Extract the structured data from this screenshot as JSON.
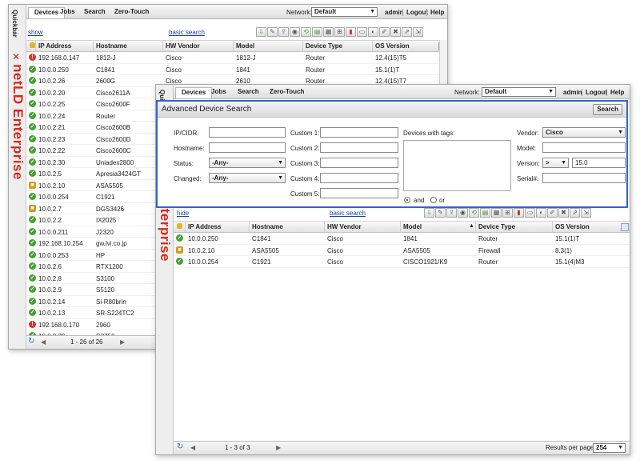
{
  "nav": {
    "tabs": [
      "Devices",
      "Jobs",
      "Search",
      "Zero-Touch"
    ],
    "network_label": "Network:",
    "network_value": "Default",
    "admin": "admin",
    "logout": "Logout",
    "help": "Help"
  },
  "sidebar": {
    "quickbar_label": "Quickbar",
    "brand": "netLD Enterprise"
  },
  "w1": {
    "toggle": "show",
    "basic_search": "basic search",
    "columns": [
      "IP Address",
      "Hostname",
      "HW Vendor",
      "Model",
      "Device Type",
      "OS Version"
    ],
    "rows": [
      {
        "status": "err",
        "ip": "192.168.0.147",
        "host": "1812-J",
        "vendor": "Cisco",
        "model": "1812-J",
        "type": "Router",
        "os": "12.4(15)T5"
      },
      {
        "status": "ok",
        "ip": "10.0.0.250",
        "host": "C1841",
        "vendor": "Cisco",
        "model": "1841",
        "type": "Router",
        "os": "15.1(1)T"
      },
      {
        "status": "ok",
        "ip": "10.0.2.26",
        "host": "2600G",
        "vendor": "Cisco",
        "model": "2610",
        "type": "Router",
        "os": "12.4(15)T7"
      },
      {
        "status": "ok",
        "ip": "10.0.2.20",
        "host": "Cisco2611A",
        "vendor": "",
        "model": "",
        "type": "",
        "os": ""
      },
      {
        "status": "ok",
        "ip": "10.0.2.25",
        "host": "Cisco2600F",
        "vendor": "",
        "model": "",
        "type": "",
        "os": ""
      },
      {
        "status": "ok",
        "ip": "10.0.2.24",
        "host": "Router",
        "vendor": "",
        "model": "",
        "type": "",
        "os": ""
      },
      {
        "status": "ok",
        "ip": "10.0.2.21",
        "host": "Cisco2600B",
        "vendor": "",
        "model": "",
        "type": "",
        "os": ""
      },
      {
        "status": "ok",
        "ip": "10.0.2.23",
        "host": "Cisco2600D",
        "vendor": "",
        "model": "",
        "type": "",
        "os": ""
      },
      {
        "status": "ok",
        "ip": "10.0.2.22",
        "host": "Cisco2600C",
        "vendor": "",
        "model": "",
        "type": "",
        "os": ""
      },
      {
        "status": "ok",
        "ip": "10.0.2.30",
        "host": "Uniadex2800",
        "vendor": "",
        "model": "",
        "type": "",
        "os": ""
      },
      {
        "status": "ok",
        "ip": "10.0.2.5",
        "host": "Apresia3424GT",
        "vendor": "",
        "model": "",
        "type": "",
        "os": ""
      },
      {
        "status": "warn",
        "ip": "10.0.2.10",
        "host": "ASA5505",
        "vendor": "",
        "model": "",
        "type": "",
        "os": ""
      },
      {
        "status": "ok",
        "ip": "10.0.0.254",
        "host": "C1921",
        "vendor": "",
        "model": "",
        "type": "",
        "os": ""
      },
      {
        "status": "warn",
        "ip": "10.0.2.7",
        "host": "DGS3426",
        "vendor": "",
        "model": "",
        "type": "",
        "os": ""
      },
      {
        "status": "ok",
        "ip": "10.0.2.2",
        "host": "IX2025",
        "vendor": "",
        "model": "",
        "type": "",
        "os": ""
      },
      {
        "status": "ok",
        "ip": "10.0.0.211",
        "host": "J2320",
        "vendor": "",
        "model": "",
        "type": "",
        "os": ""
      },
      {
        "status": "ok",
        "ip": "192.168.10.254",
        "host": "gw.lvi.co.jp",
        "vendor": "",
        "model": "",
        "type": "",
        "os": ""
      },
      {
        "status": "ok",
        "ip": "10.0.0.253",
        "host": "HP",
        "vendor": "",
        "model": "",
        "type": "",
        "os": ""
      },
      {
        "status": "ok",
        "ip": "10.0.2.6",
        "host": "RTX1200",
        "vendor": "",
        "model": "",
        "type": "",
        "os": ""
      },
      {
        "status": "ok",
        "ip": "10.0.2.8",
        "host": "S3100",
        "vendor": "",
        "model": "",
        "type": "",
        "os": ""
      },
      {
        "status": "ok",
        "ip": "10.0.2.9",
        "host": "S5120",
        "vendor": "",
        "model": "",
        "type": "",
        "os": ""
      },
      {
        "status": "ok",
        "ip": "10.0.2.14",
        "host": "Si-R80brin",
        "vendor": "",
        "model": "",
        "type": "",
        "os": ""
      },
      {
        "status": "ok",
        "ip": "10.0.2.13",
        "host": "SR-S224TC2",
        "vendor": "",
        "model": "",
        "type": "",
        "os": ""
      },
      {
        "status": "err",
        "ip": "192.168.0.170",
        "host": "2960",
        "vendor": "",
        "model": "",
        "type": "",
        "os": ""
      },
      {
        "status": "ok",
        "ip": "10.0.2.29",
        "host": "C3750",
        "vendor": "",
        "model": "",
        "type": "",
        "os": ""
      },
      {
        "status": "ok",
        "ip": "10.0.2.27",
        "host": "Cisco2500A",
        "vendor": "",
        "model": "",
        "type": "",
        "os": ""
      }
    ],
    "pagination": "1 - 26 of 26"
  },
  "w2": {
    "adv": {
      "title": "Advanced Device Search",
      "search_button": "Search",
      "ip_label": "IP/CIDR:",
      "hostname_label": "Hostname:",
      "status_label": "Status:",
      "status_value": "-Any-",
      "changed_label": "Changed:",
      "changed_value": "-Any-",
      "custom_labels": [
        "Custom 1:",
        "Custom 2:",
        "Custom 3:",
        "Custom 4:",
        "Custom 5:"
      ],
      "tags_label": "Devices with tags:",
      "and_label": "and",
      "or_label": "or",
      "vendor_label": "Vendor:",
      "vendor_value": "Cisco",
      "model_label": "Model:",
      "version_label": "Version:",
      "version_op": ">",
      "version_value": "15.0",
      "serial_label": "Serial#:"
    },
    "toggle": "hide",
    "basic_search": "basic search",
    "columns": [
      "IP Address",
      "Hostname",
      "HW Vendor",
      "Model",
      "Device Type",
      "OS Version"
    ],
    "rows": [
      {
        "status": "ok",
        "ip": "10.0.0.250",
        "host": "C1841",
        "vendor": "Cisco",
        "model": "1841",
        "type": "Router",
        "os": "15.1(1)T"
      },
      {
        "status": "warn",
        "ip": "10.0.2.10",
        "host": "ASA5505",
        "vendor": "Cisco",
        "model": "ASA5505",
        "type": "Firewall",
        "os": "8.3(1)"
      },
      {
        "status": "ok",
        "ip": "10.0.0.254",
        "host": "C1921",
        "vendor": "Cisco",
        "model": "CISCO1921/K9",
        "type": "Router",
        "os": "15.1(4)M3"
      }
    ],
    "pagination": "1 - 3 of 3",
    "results_per_page_label": "Results per page:",
    "results_per_page": "254"
  }
}
